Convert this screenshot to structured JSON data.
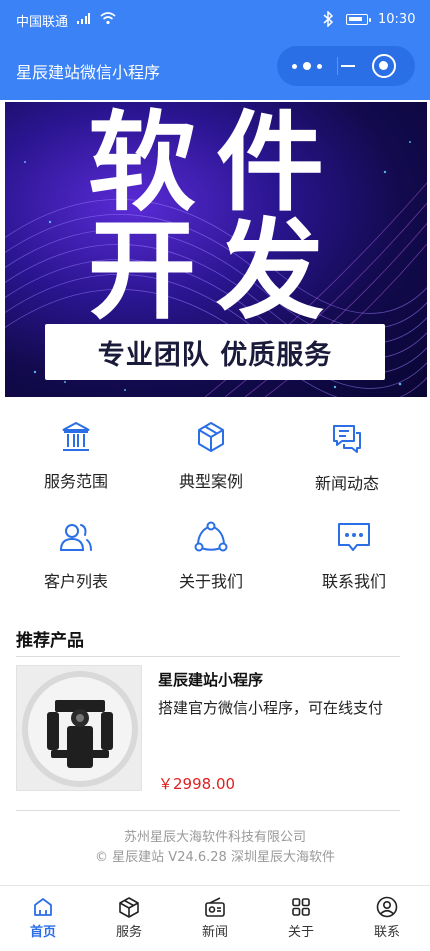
{
  "status_bar": {
    "carrier": "中国联通",
    "time": "10:30"
  },
  "nav": {
    "title": "星辰建站微信小程序"
  },
  "banner": {
    "line1": "软件",
    "line2": "开发",
    "tagline": "专业团队 优质服务"
  },
  "grid": {
    "items": [
      {
        "label": "服务范围",
        "icon": "bank-icon"
      },
      {
        "label": "典型案例",
        "icon": "box-icon"
      },
      {
        "label": "新闻动态",
        "icon": "chat-icon"
      },
      {
        "label": "客户列表",
        "icon": "users-icon"
      },
      {
        "label": "关于我们",
        "icon": "share-icon"
      },
      {
        "label": "联系我们",
        "icon": "message-icon"
      }
    ]
  },
  "section": {
    "title": "推荐产品"
  },
  "product": {
    "name": "星辰建站小程序",
    "desc": "搭建官方微信小程序，可在线支付",
    "price": "￥2998.00"
  },
  "footer": {
    "company": "苏州星辰大海软件科技有限公司",
    "copyright": "© 星辰建站 V24.6.28 深圳星辰大海软件"
  },
  "tabbar": {
    "tabs": [
      {
        "label": "首页",
        "icon": "home-icon",
        "active": true
      },
      {
        "label": "服务",
        "icon": "cube-icon",
        "active": false
      },
      {
        "label": "新闻",
        "icon": "radio-icon",
        "active": false
      },
      {
        "label": "关于",
        "icon": "apps-icon",
        "active": false
      },
      {
        "label": "联系",
        "icon": "contact-icon",
        "active": false
      }
    ]
  },
  "colors": {
    "primary": "#3a82f6",
    "active_tab": "#2b6fe6",
    "price": "#e02020"
  }
}
